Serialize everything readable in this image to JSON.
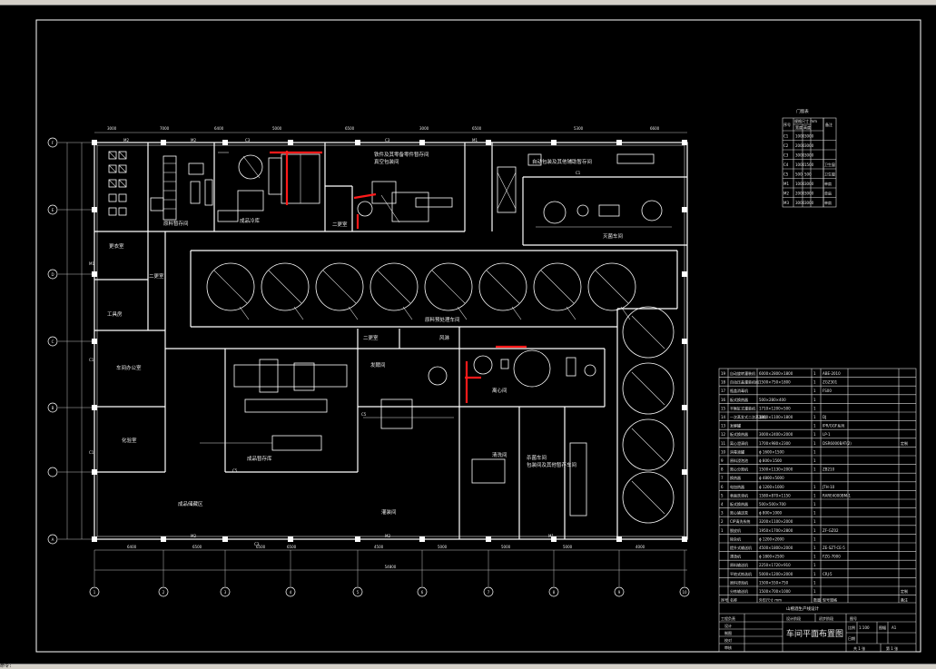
{
  "door_schedule": {
    "title": "门窗表",
    "headers": [
      "序号",
      "规格尺寸 mm",
      "备注"
    ],
    "subheaders": [
      "宽度",
      "高度"
    ],
    "rows": [
      [
        "C1",
        "1000",
        "3000",
        ""
      ],
      [
        "C2",
        "2000",
        "3000",
        ""
      ],
      [
        "C3",
        "3000",
        "3000",
        ""
      ],
      [
        "C4",
        "1000",
        "1500",
        "卫生窗"
      ],
      [
        "C5",
        "500",
        "500",
        "卫生窗"
      ],
      [
        "M1",
        "1000",
        "3000",
        "单扇"
      ],
      [
        "M2",
        "2000",
        "3000",
        "单扇"
      ],
      [
        "M3",
        "3000",
        "3000",
        "单扇"
      ]
    ]
  },
  "rooms": {
    "r1": "自动包装及其他辅助暂存间",
    "r2": "铁件及其零备零件暂存间",
    "r3": "真空包装间",
    "r4": "灭菌车间",
    "r5": "成品冷库",
    "r6": "发酵间",
    "r7": "清洗间",
    "r8": "原料预处理车间",
    "r9": "成品储藏区",
    "r10": "离心间",
    "r11": "原料暂存间",
    "r12": "灌装间",
    "r13": "更衣室",
    "r14": "化验室",
    "r15": "车间办公室",
    "r16": "工具房",
    "r17": "成品暂存库",
    "r18": "杀菌车间",
    "r19": "包装间及其他暂存车间",
    "r20": "二更室",
    "r21": "风淋",
    "r22": "二更室",
    "r23": "二更室"
  },
  "axis_rows": [
    "F",
    "E",
    "D",
    "C",
    "B",
    "A"
  ],
  "axis_cols": [
    "1",
    "2",
    "3",
    "4",
    "5",
    "6",
    "7",
    "8",
    "9",
    "10"
  ],
  "top_dims": [
    "3000",
    "7000",
    "6400",
    "5000",
    "6500",
    "3000",
    "6500",
    "5300",
    "6600"
  ],
  "bottom_dims": [
    "6400",
    "6500",
    "6500",
    "6500",
    "4500",
    "5000",
    "5000",
    "5000",
    "4000"
  ],
  "overall_dim": "54800",
  "door_marks": [
    "M2",
    "C3",
    "M1",
    "C2",
    "M3",
    "C4",
    "C1",
    "C5"
  ],
  "equipment_table": {
    "rows": [
      [
        "19",
        "自动旋转灌装机",
        "6000×2800×1800",
        "1",
        "ABE-2010",
        ""
      ],
      [
        "18",
        "自动压盖灌装机组",
        "1500×750×1800",
        "1",
        "ZGZ301",
        ""
      ],
      [
        "17",
        "瓶盖消毒机",
        "",
        "1",
        "FS00",
        ""
      ],
      [
        "16",
        "板式换热器",
        "500×280×400",
        "1",
        "",
        ""
      ],
      [
        "15",
        "平衡缸式灌装机",
        "1710×1200×500",
        "1",
        "",
        ""
      ],
      [
        "14",
        "一次蒸发式二次蒸发机",
        "2800×1100×1800",
        "1",
        "DJ",
        ""
      ],
      [
        "13",
        "发酵罐",
        "",
        "1",
        "IPR/GGF系列",
        ""
      ],
      [
        "12",
        "板式换热器",
        "3000×2400×2000",
        "1",
        "LP-1",
        ""
      ],
      [
        "11",
        "离心澄清机",
        "1700×980×2300",
        "1",
        "DSR6000BAT(2)",
        "定制"
      ],
      [
        "10",
        "消毒液罐",
        "ϕ 1600×1500",
        "1",
        "",
        ""
      ],
      [
        "9",
        "原料浸泡池",
        "ϕ 800×1500",
        "1",
        "",
        ""
      ],
      [
        "8",
        "离心分离机",
        "1500×1130×2000",
        "1",
        "ZB210",
        ""
      ],
      [
        "7",
        "换热器",
        "ϕ 4800×5000",
        "",
        "",
        ""
      ],
      [
        "6",
        "电加热器",
        "ϕ 1200×1000",
        "1",
        "JTH-10",
        ""
      ],
      [
        "5",
        "表面洗涤机",
        "1580×870×1150",
        "1",
        "RARE4000BM-1",
        ""
      ],
      [
        "4",
        "板式换热器",
        "500×500×700",
        "1",
        "",
        ""
      ],
      [
        "3",
        "离心输送泵",
        "ϕ 800×1000",
        "1",
        "",
        ""
      ],
      [
        "2",
        "CIP清洗系统",
        "3200×1100×2000",
        "1",
        "",
        ""
      ],
      [
        "1",
        "脱皮机",
        "1950×1700×2800",
        "1",
        "ZF-GZ02",
        ""
      ],
      [
        "",
        "除杂机",
        "ϕ 1200×2000",
        "1",
        "",
        ""
      ],
      [
        "",
        "提升式输送机",
        "4500×1800×2000",
        "1",
        "ZE-SZT-CE-5",
        ""
      ],
      [
        "",
        "漂烫机",
        "ϕ 1800×2500",
        "1",
        "FZG-7000",
        ""
      ],
      [
        "",
        "原料输送机",
        "2250×1720×910",
        "1",
        "",
        ""
      ],
      [
        "",
        "平地式拣选机",
        "5000×1200×2000",
        "1",
        "CRJ-5",
        ""
      ],
      [
        "",
        "原料浸泡机",
        "1500×550×750",
        "1",
        "",
        ""
      ],
      [
        "",
        "分拣输送机",
        "1500×700×1000",
        "1",
        "",
        "定制"
      ]
    ],
    "footer": [
      "序号",
      "名称",
      "外形尺寸 mm",
      "数量",
      "型号规格",
      "备注"
    ]
  },
  "title_block": {
    "design_name": "山楂酒生产线设计",
    "drawing_title": "车间平面布置图",
    "rows": [
      "工程负责",
      "设计",
      "制图",
      "校对",
      "审核"
    ],
    "stage_label": "设计阶段",
    "stage_value": "初步阶段",
    "scale_label": "比例",
    "scale": "1:100",
    "sheet_label": "图幅",
    "sheet": "A1",
    "sheet_count": "共 1 张",
    "sheet_no": "第 1 张",
    "no_label": "图号",
    "date_label": "日期"
  },
  "statusbar_text": "命令:"
}
